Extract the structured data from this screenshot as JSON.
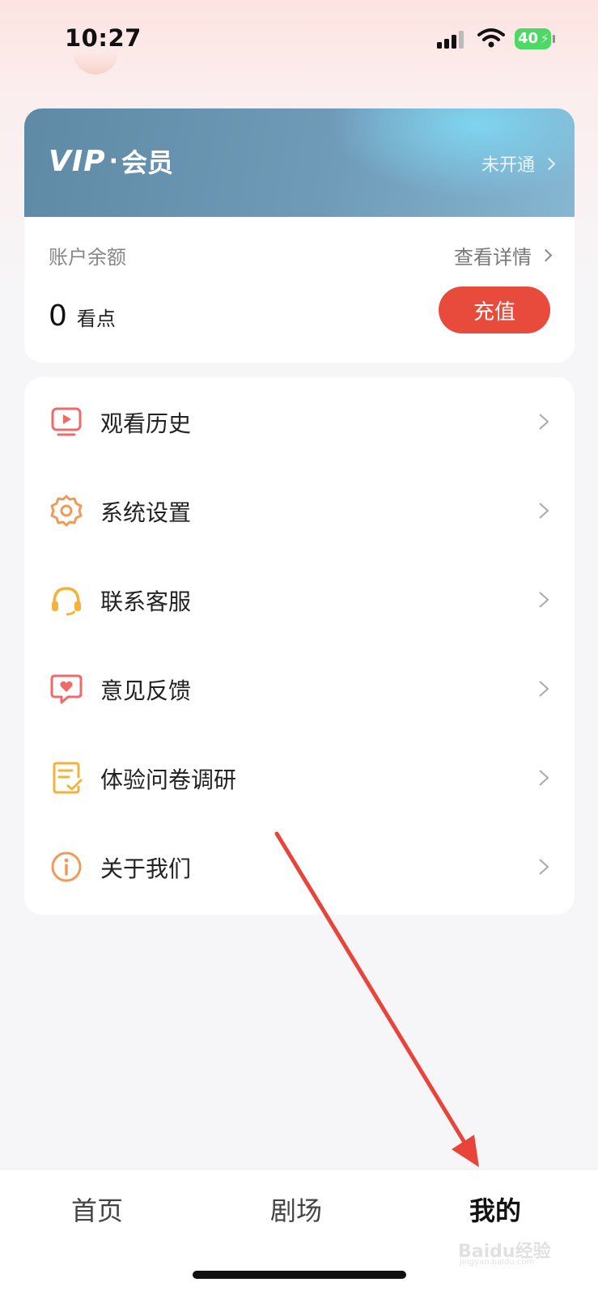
{
  "status_bar": {
    "time": "10:27",
    "battery_level": "40"
  },
  "vip": {
    "logo_vip": "VIP",
    "logo_member": "会员",
    "status_label": "未开通"
  },
  "balance": {
    "label": "账户余额",
    "detail_label": "查看详情",
    "value": "0",
    "unit": "看点",
    "recharge_label": "充值"
  },
  "menu": {
    "items": [
      {
        "label": "观看历史",
        "icon": "play-history-icon"
      },
      {
        "label": "系统设置",
        "icon": "gear-icon"
      },
      {
        "label": "联系客服",
        "icon": "headset-icon"
      },
      {
        "label": "意见反馈",
        "icon": "feedback-heart-icon"
      },
      {
        "label": "体验问卷调研",
        "icon": "survey-icon"
      },
      {
        "label": "关于我们",
        "icon": "info-icon"
      }
    ]
  },
  "bottom_nav": {
    "tabs": [
      {
        "label": "首页",
        "active": false
      },
      {
        "label": "剧场",
        "active": false
      },
      {
        "label": "我的",
        "active": true
      }
    ]
  },
  "colors": {
    "accent_red": "#e84b3c",
    "annotation_arrow": "#e8443a",
    "icon_pink": "#ee6b6b",
    "icon_orange": "#f09a5a",
    "icon_yellow": "#f5b23a"
  },
  "watermark": {
    "text": "Baidu经验",
    "sub": "jingyan.baidu.com"
  }
}
